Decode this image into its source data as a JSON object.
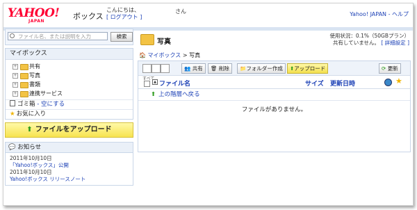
{
  "header": {
    "logo_text": "YAHOO!",
    "logo_sub": "JAPAN",
    "service_name": "ボックス",
    "greeting": "こんにちは、",
    "logout_label": "[ ログアウト ]",
    "user_suffix": "さん",
    "top_links": "Yahoo! JAPAN - ヘルプ"
  },
  "sidebar": {
    "search_placeholder": "ファイル名、または説明を入力",
    "search_button": "検索",
    "mybox_title": "マイボックス",
    "tree": [
      {
        "label": "共有"
      },
      {
        "label": "写真"
      },
      {
        "label": "書類"
      },
      {
        "label": "連携サービス"
      }
    ],
    "trash_label": "ゴミ箱",
    "empty_trash": "- 空にする",
    "favorites_label": "お気に入り",
    "upload_button": "ファイルをアップロード",
    "news_title": "お知らせ",
    "news": [
      {
        "date": "2011年10月10日",
        "title": "「Yahoo!ボックス」公開"
      },
      {
        "date": "2011年10月10日",
        "title": "Yahoo!ボックス リリースノート"
      }
    ]
  },
  "main": {
    "folder_title": "写真",
    "usage_line1": "使用状況：0.1%（50GBプラン）",
    "usage_line2": "共有していません。",
    "details_link": "[ 詳細設定 ]",
    "breadcrumb_root": "マイボックス",
    "breadcrumb_sep": ">",
    "breadcrumb_current": "写真",
    "toolbar": {
      "share": "共有",
      "delete": "削除",
      "new_folder": "フォルダー作成",
      "upload": "アップロード",
      "refresh": "更新"
    },
    "columns": {
      "select_all": "すべて",
      "name": "ファイル名",
      "size": "サイズ",
      "updated": "更新日時"
    },
    "up_link": "上の階層へ戻る",
    "empty_message": "ファイルがありません。"
  },
  "colors": {
    "yahoo_red": "#ff0033",
    "link_blue": "#1a3fb5",
    "panel_bg": "#eaf0f8",
    "upload_yellow": "#f7e34f"
  }
}
